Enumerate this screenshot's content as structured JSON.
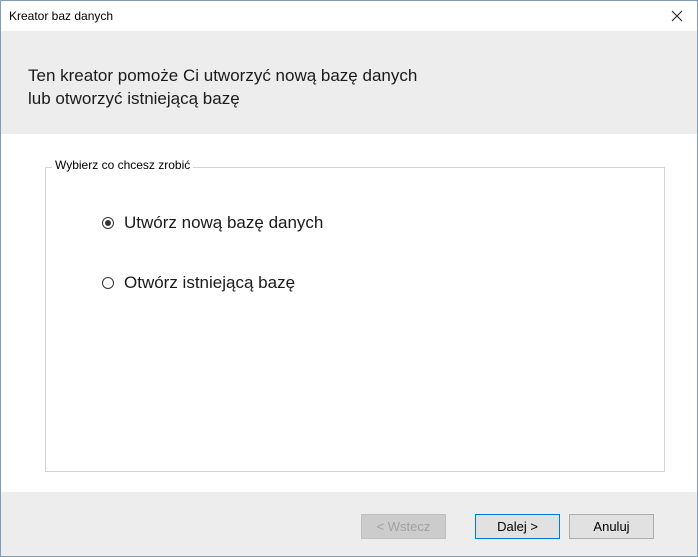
{
  "window": {
    "title": "Kreator baz danych",
    "close_glyph": "✕"
  },
  "header": {
    "line1": "Ten kreator pomoże Ci utworzyć nową bazę danych",
    "line2": "lub otworzyć istniejącą bazę"
  },
  "group": {
    "legend": "Wybierz co chcesz zrobić",
    "options": [
      {
        "label": "Utwórz nową bazę danych",
        "selected": true
      },
      {
        "label": "Otwórz istniejącą bazę",
        "selected": false
      }
    ]
  },
  "footer": {
    "back_label": "< Wstecz",
    "next_label": "Dalej >",
    "cancel_label": "Anuluj"
  }
}
